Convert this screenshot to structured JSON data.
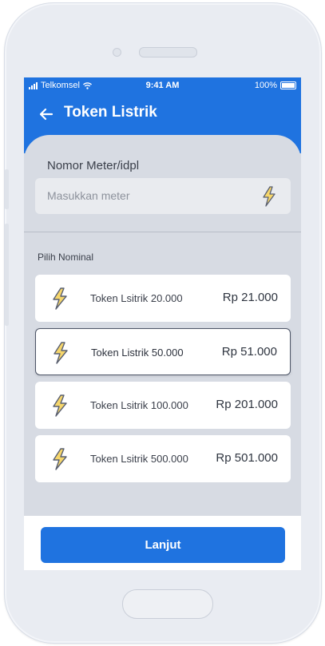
{
  "status_bar": {
    "carrier": "Telkomsel",
    "time": "9:41 AM",
    "battery": "100%"
  },
  "header": {
    "title": "Token Listrik",
    "back_icon": "arrow-left-icon"
  },
  "meter": {
    "label": "Nomor Meter/idpl",
    "placeholder": "Masukkan meter",
    "icon": "lightning-icon"
  },
  "nominal": {
    "label": "Pilih Nominal",
    "options": [
      {
        "name": "Token Lsitrik 20.000",
        "price": "Rp 21.000",
        "selected": false
      },
      {
        "name": "Token Listrik 50.000",
        "price": "Rp 51.000",
        "selected": true
      },
      {
        "name": "Token Lsitrik 100.000",
        "price": "Rp 201.000",
        "selected": false
      },
      {
        "name": "Token Lsitrik 500.000",
        "price": "Rp 501.000",
        "selected": false
      }
    ]
  },
  "footer": {
    "next_label": "Lanjut"
  },
  "colors": {
    "primary": "#1f73e0",
    "icon_fill": "#f6d66b",
    "icon_stroke": "#5a6070"
  }
}
